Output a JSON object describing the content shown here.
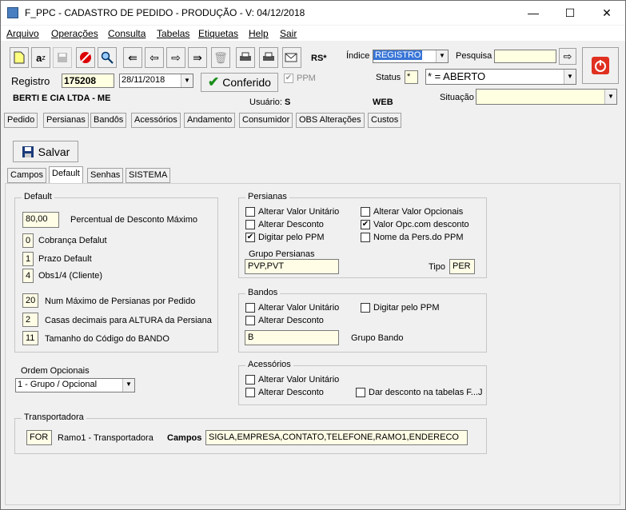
{
  "window": {
    "title": "F_PPC - CADASTRO DE PEDIDO - PRODUÇÃO - V: 04/12/2018",
    "minimize": "—",
    "maximize": "☐",
    "close": "✕"
  },
  "menu": [
    "Arquivo",
    "Operações",
    "Consulta",
    "Tabelas",
    "Etiquetas",
    "Help",
    "Sair"
  ],
  "toolbar": {
    "icons": [
      "new-document-icon",
      "spellcheck-icon",
      "save-disk-icon",
      "cancel-icon",
      "search-icon",
      "first-icon",
      "prev-icon",
      "next-icon",
      "last-icon",
      "trash-icon",
      "print-icon",
      "print-preview-icon",
      "email-icon"
    ],
    "rs_label": "RS*"
  },
  "header": {
    "indice_label": "Índice",
    "indice_value": "REGISTRO",
    "pesquisa_label": "Pesquisa",
    "pesquisa_value": "",
    "registro_label": "Registro",
    "registro_value": "175208",
    "date_value": "28/11/2018",
    "conferido_label": "Conferido",
    "ppm_label": "PPM",
    "status_label": "Status",
    "status_code": "*",
    "status_value": "* = ABERTO",
    "company": "BERTI E CIA LTDA - ME",
    "usuario_label": "Usuário:",
    "usuario_value": "S",
    "web_label": "WEB",
    "situacao_label": "Situação",
    "situacao_value": ""
  },
  "tabs": [
    "Pedido",
    "Persianas",
    "Bandôs",
    "Acessórios",
    "Andamento",
    "Consumidor",
    "OBS Alterações",
    "Custos"
  ],
  "save_label": "Salvar",
  "subtabs": [
    "Campos",
    "Default",
    "Senhas",
    "SISTEMA"
  ],
  "default_group": {
    "title": "Default",
    "perc_desconto_value": "80,00",
    "perc_desconto_label": "Percentual de Desconto Máximo",
    "cobranca_value": "0",
    "cobranca_label": "Cobrança Defalut",
    "prazo_value": "1",
    "prazo_label": "Prazo Default",
    "obs_value": "4",
    "obs_label": "Obs1/4 (Cliente)",
    "max_persianas_value": "20",
    "max_persianas_label": "Num Máximo de Persianas por Pedido",
    "casas_value": "2",
    "casas_label": "Casas decimais para ALTURA da Persiana",
    "tamanho_value": "11",
    "tamanho_label": "Tamanho do Código do BANDO"
  },
  "ordem": {
    "label": "Ordem Opcionais",
    "value": "1 - Grupo / Opcional"
  },
  "persianas": {
    "title": "Persianas",
    "chk1": "Alterar Valor Unitário",
    "chk2": "Alterar Desconto",
    "chk3": "Digitar pelo PPM",
    "chk4": "Alterar Valor Opcionais",
    "chk5": "Valor Opc.com desconto",
    "chk6": "Nome da Pers.do PPM",
    "grupo_label": "Grupo Persianas",
    "grupo_value": "PVP,PVT",
    "tipo_label": "Tipo",
    "tipo_value": "PER",
    "check_mark": "✔"
  },
  "bandos": {
    "title": "Bandos",
    "chk1": "Alterar Valor Unitário",
    "chk2": "Alterar Desconto",
    "chk3": "Digitar pelo PPM",
    "grupo_value": "B",
    "grupo_label": "Grupo Bando"
  },
  "acessorios": {
    "title": "Acessórios",
    "chk1": "Alterar Valor Unitário",
    "chk2": "Alterar Desconto",
    "chk3": "Dar desconto na tabelas F...J"
  },
  "transportadora": {
    "title": "Transportadora",
    "code_value": "FOR",
    "code_label": "Ramo1 - Transportadora",
    "campos_label": "Campos",
    "campos_value": "SIGLA,EMPRESA,CONTATO,TELEFONE,RAMO1,ENDERECO"
  }
}
